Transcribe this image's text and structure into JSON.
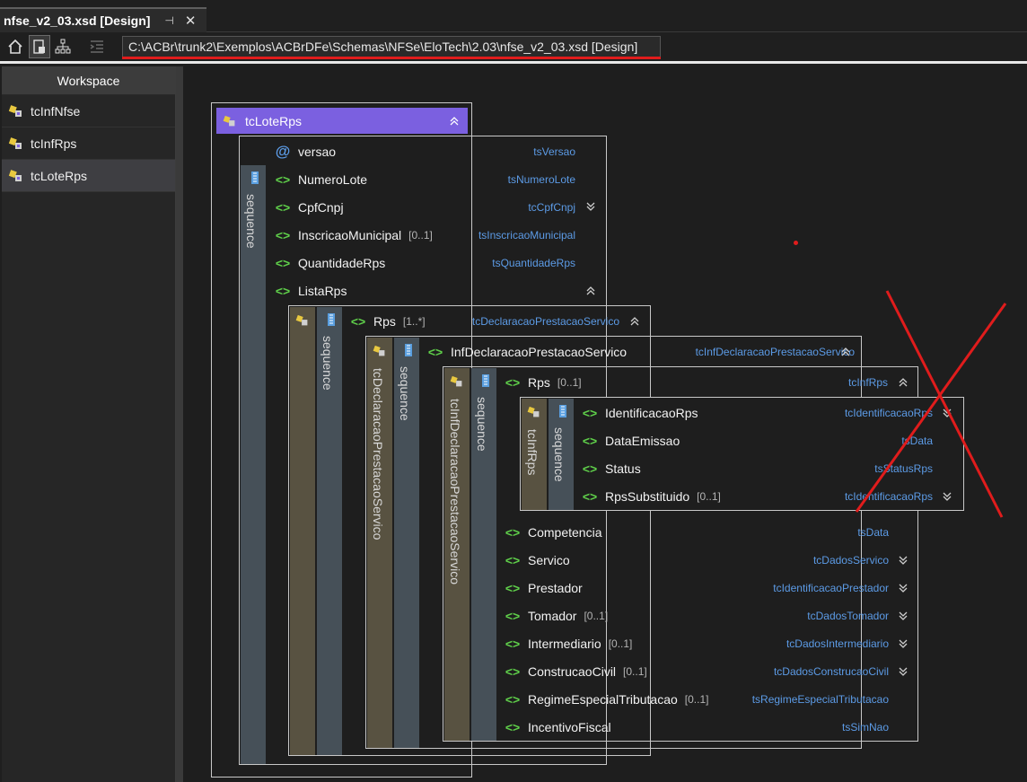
{
  "tab": {
    "title": "nfse_v2_03.xsd [Design]",
    "pin_glyph": "⊣",
    "close_glyph": "✕"
  },
  "toolbar": {
    "path": "C:\\ACBr\\trunk2\\Exemplos\\ACBrDFe\\Schemas\\NFSe\\EloTech\\2.03\\nfse_v2_03.xsd [Design]",
    "buttons": [
      "home-icon",
      "design-view-icon",
      "hierarchy-icon",
      "indent-icon"
    ]
  },
  "workspace": {
    "title": "Workspace",
    "items": [
      {
        "label": "tcInfNfse"
      },
      {
        "label": "tcInfRps"
      },
      {
        "label": "tcLoteRps"
      }
    ]
  },
  "design": {
    "root": {
      "label": "tcLoteRps",
      "seq_label": "sequence"
    },
    "lote_rows": [
      {
        "name": "versao",
        "occ": "",
        "type": "tsVersao",
        "kind": "attribute"
      },
      {
        "name": "NumeroLote",
        "occ": "",
        "type": "tsNumeroLote",
        "kind": "element"
      },
      {
        "name": "CpfCnpj",
        "occ": "",
        "type": "tcCpfCnpj",
        "kind": "element"
      },
      {
        "name": "InscricaoMunicipal",
        "occ": "[0..1]",
        "type": "tsInscricaoMunicipal",
        "kind": "element"
      },
      {
        "name": "QuantidadeRps",
        "occ": "",
        "type": "tsQuantidadeRps",
        "kind": "element"
      },
      {
        "name": "ListaRps",
        "occ": "",
        "type": "",
        "kind": "element"
      }
    ],
    "rps": {
      "name": "Rps",
      "occ": "[1..*]",
      "type": "tcDeclaracaoPrestacaoServico",
      "seq_label": "sequence"
    },
    "inf_decl": {
      "name": "InfDeclaracaoPrestacaoServico",
      "type": "tcInfDeclaracaoPrestacaoServico",
      "side_label": "tcDeclaracaoPrestacaoServico",
      "seq_label": "sequence"
    },
    "rps_inner": {
      "name": "Rps",
      "occ": "[0..1]",
      "type": "tcInfRps",
      "side_label": "tcInfDeclaracaoPrestacaoServico",
      "seq_label": "sequence"
    },
    "inf_rps": {
      "side_label": "tcInfRps",
      "seq_label": "sequence",
      "rows": [
        {
          "name": "IdentificacaoRps",
          "occ": "",
          "type": "tcIdentificacaoRps"
        },
        {
          "name": "DataEmissao",
          "occ": "",
          "type": "tsData"
        },
        {
          "name": "Status",
          "occ": "",
          "type": "tsStatusRps"
        },
        {
          "name": "RpsSubstituido",
          "occ": "[0..1]",
          "type": "tcIdentificacaoRps"
        }
      ]
    },
    "decl_rows": [
      {
        "name": "Competencia",
        "occ": "",
        "type": "tsData"
      },
      {
        "name": "Servico",
        "occ": "",
        "type": "tcDadosServico"
      },
      {
        "name": "Prestador",
        "occ": "",
        "type": "tcIdentificacaoPrestador"
      },
      {
        "name": "Tomador",
        "occ": "[0..1]",
        "type": "tcDadosTomador"
      },
      {
        "name": "Intermediario",
        "occ": "[0..1]",
        "type": "tcDadosIntermediario"
      },
      {
        "name": "ConstrucaoCivil",
        "occ": "[0..1]",
        "type": "tcDadosConstrucaoCivil"
      },
      {
        "name": "RegimeEspecialTributacao",
        "occ": "[0..1]",
        "type": "tsRegimeEspecialTributacao"
      },
      {
        "name": "IncentivoFiscal",
        "occ": "",
        "type": "tsSimNao"
      }
    ]
  },
  "colors": {
    "header": "#7b60e0",
    "element_icon": "#5fcf4a",
    "type_text": "#5c9be6",
    "annotation_red": "#e01c1c"
  }
}
